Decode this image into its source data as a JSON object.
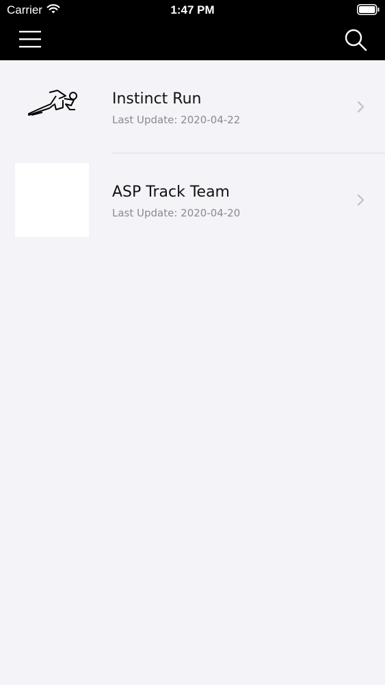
{
  "status_bar": {
    "carrier": "Carrier",
    "time": "1:47 PM"
  },
  "nav": {
    "menu_icon": "hamburger-menu-icon",
    "search_icon": "search-icon"
  },
  "items": [
    {
      "title": "Instinct Run",
      "subtitle": "Last Update: 2020-04-22",
      "thumb": "runner-icon"
    },
    {
      "title": "ASP Track Team",
      "subtitle": "Last Update: 2020-04-20",
      "thumb": "blank"
    }
  ],
  "colors": {
    "topbar": "#000000",
    "background": "#f4f3f7",
    "subtitle": "#8a8a8f"
  }
}
